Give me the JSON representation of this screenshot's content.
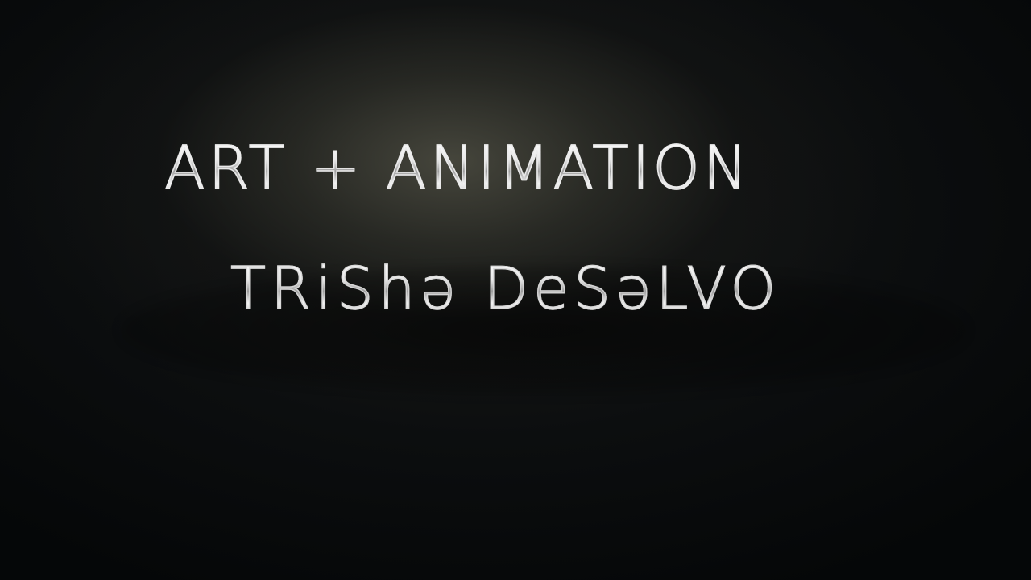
{
  "title": {
    "line1": "ART + ANIMATION",
    "line2": "TRiShə DeSəLVO"
  }
}
